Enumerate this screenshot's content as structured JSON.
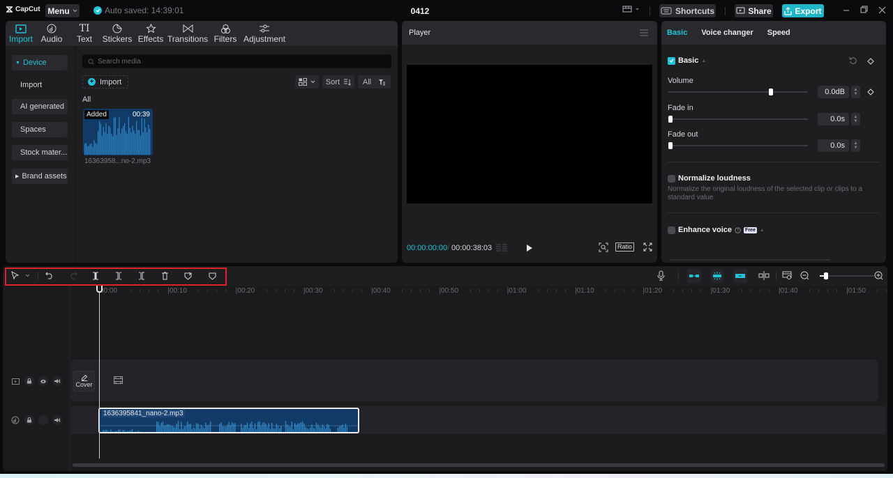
{
  "app": {
    "brand": "CapCut",
    "menu_label": "Menu",
    "autosave_text": "Auto saved: 14:39:01",
    "project_title": "0412",
    "shortcuts_label": "Shortcuts",
    "share_label": "Share",
    "export_label": "Export",
    "accent_color": "#22c3d8"
  },
  "media_tabs": [
    {
      "label": "Import",
      "icon": "import-icon",
      "active": true
    },
    {
      "label": "Audio",
      "icon": "audio-icon",
      "active": false
    },
    {
      "label": "Text",
      "icon": "text-icon",
      "active": false
    },
    {
      "label": "Stickers",
      "icon": "sticker-icon",
      "active": false
    },
    {
      "label": "Effects",
      "icon": "effects-icon",
      "active": false
    },
    {
      "label": "Transitions",
      "icon": "transitions-icon",
      "active": false
    },
    {
      "label": "Filters",
      "icon": "filters-icon",
      "active": false
    },
    {
      "label": "Adjustment",
      "icon": "adjustment-icon",
      "active": false
    }
  ],
  "sidebar": {
    "items": [
      {
        "label": "Device",
        "active": true,
        "expandable": true
      },
      {
        "label": "Import",
        "active": false
      },
      {
        "label": "AI generated",
        "active": false
      },
      {
        "label": "Spaces",
        "active": false
      },
      {
        "label": "Stock mater...",
        "active": false
      },
      {
        "label": "Brand assets",
        "active": false,
        "expandable": true
      }
    ]
  },
  "media": {
    "search_placeholder": "Search media",
    "import_label": "Import",
    "sort_label": "Sort",
    "filter_label": "All",
    "section_label": "All",
    "items": [
      {
        "badge": "Added",
        "duration": "00:39",
        "name": "16363958...no-2.mp3"
      }
    ]
  },
  "player": {
    "title": "Player",
    "current_time": "00:00:00:00",
    "total_time": "00:00:38:03",
    "ratio_label": "Ratio"
  },
  "properties": {
    "tabs": [
      {
        "label": "Basic",
        "active": true
      },
      {
        "label": "Voice changer",
        "active": false
      },
      {
        "label": "Speed",
        "active": false
      }
    ],
    "basic_section": {
      "label": "Basic",
      "checked": true
    },
    "volume": {
      "label": "Volume",
      "value": "0.0dB",
      "slider_fraction": 0.74
    },
    "fade_in": {
      "label": "Fade in",
      "value": "0.0s",
      "slider_fraction": 0.0
    },
    "fade_out": {
      "label": "Fade out",
      "value": "0.0s",
      "slider_fraction": 0.0
    },
    "normalize": {
      "label": "Normalize loudness",
      "checked": false,
      "description": "Normalize the original loudness of the selected clip or clips to a standard value"
    },
    "enhance": {
      "label": "Enhance voice",
      "checked": false,
      "badge": "Free"
    }
  },
  "timeline": {
    "ruler_labels": [
      "00:00",
      "00:10",
      "00:20",
      "00:30",
      "00:40",
      "00:50",
      "01:00",
      "01:10",
      "01:20",
      "01:30",
      "01:40",
      "01:50"
    ],
    "cover_label": "Cover",
    "audio_clip_name": "1636395841_nano-2.mp3",
    "zoom_fraction": 0.08,
    "toolbar_tools": [
      "select",
      "undo",
      "redo",
      "split",
      "split-left",
      "split-right",
      "delete",
      "mark",
      "shield"
    ]
  }
}
